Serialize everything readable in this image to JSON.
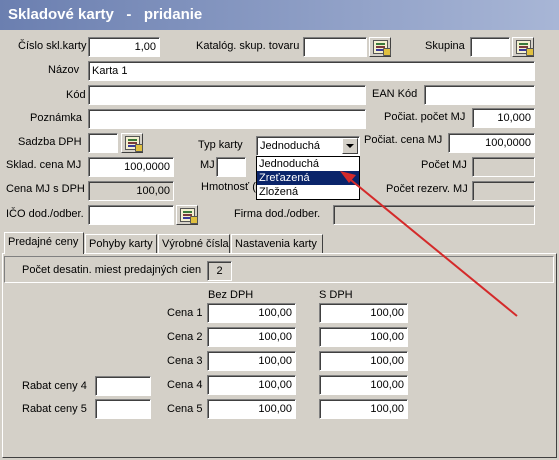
{
  "window": {
    "title": "Skladové karty   -   pridanie"
  },
  "form": {
    "cislo_label": "Číslo skl.karty",
    "cislo_value": "1,00",
    "katalog_label": "Katalóg. skup. tovaru",
    "katalog_value": "",
    "skupina_label": "Skupina",
    "skupina_value": "",
    "nazov_label": "Názov",
    "nazov_value": "Karta 1",
    "kod_label": "Kód",
    "kod_value": "",
    "ean_label": "EAN Kód",
    "ean_value": "",
    "poznamka_label": "Poznámka",
    "poznamka_value": "",
    "pocat_pocet_label": "Počiat. počet MJ",
    "pocat_pocet_value": "10,000",
    "sadzba_label": "Sadzba DPH",
    "sadzba_value": "",
    "typ_label": "Typ karty",
    "typ_value": "Jednoduchá",
    "pocat_cena_label": "Počiat. cena MJ",
    "pocat_cena_value": "100,0000",
    "sklad_cena_label": "Sklad. cena MJ",
    "sklad_cena_value": "100,0000",
    "mj_label": "MJ",
    "mj_value": "",
    "pocet_mj_label": "Počet MJ",
    "pocet_mj_value": "",
    "cena_mj_dph_label": "Cena MJ s DPH",
    "cena_mj_dph_value": "100,00",
    "hmotnost_label": "Hmotnosť (k",
    "pocet_rezerv_label": "Počet rezerv. MJ",
    "pocet_rezerv_value": "",
    "ico_label": "IČO dod./odber.",
    "ico_value": "",
    "firma_label": "Firma dod./odber.",
    "firma_value": ""
  },
  "dropdown": {
    "options": [
      "Jednoduchá",
      "Zreťazená",
      "Zložená"
    ],
    "selected_index": 1
  },
  "tabs": [
    "Predajné ceny",
    "Pohyby karty",
    "Výrobné čísla",
    "Nastavenia karty"
  ],
  "prices": {
    "decimals_label": "Počet desatin. miest predajných cien",
    "decimals_value": "2",
    "col_bez": "Bez DPH",
    "col_s": "S DPH",
    "rows": [
      {
        "label": "Cena 1",
        "bez": "100,00",
        "s": "100,00"
      },
      {
        "label": "Cena 2",
        "bez": "100,00",
        "s": "100,00"
      },
      {
        "label": "Cena 3",
        "bez": "100,00",
        "s": "100,00"
      },
      {
        "label": "Cena 4",
        "bez": "100,00",
        "s": "100,00"
      },
      {
        "label": "Cena 5",
        "bez": "100,00",
        "s": "100,00"
      }
    ],
    "rabat4_label": "Rabat ceny 4",
    "rabat4_value": "",
    "rabat5_label": "Rabat ceny 5",
    "rabat5_value": ""
  },
  "annotation": {
    "arrow_color": "#d42a2a"
  }
}
